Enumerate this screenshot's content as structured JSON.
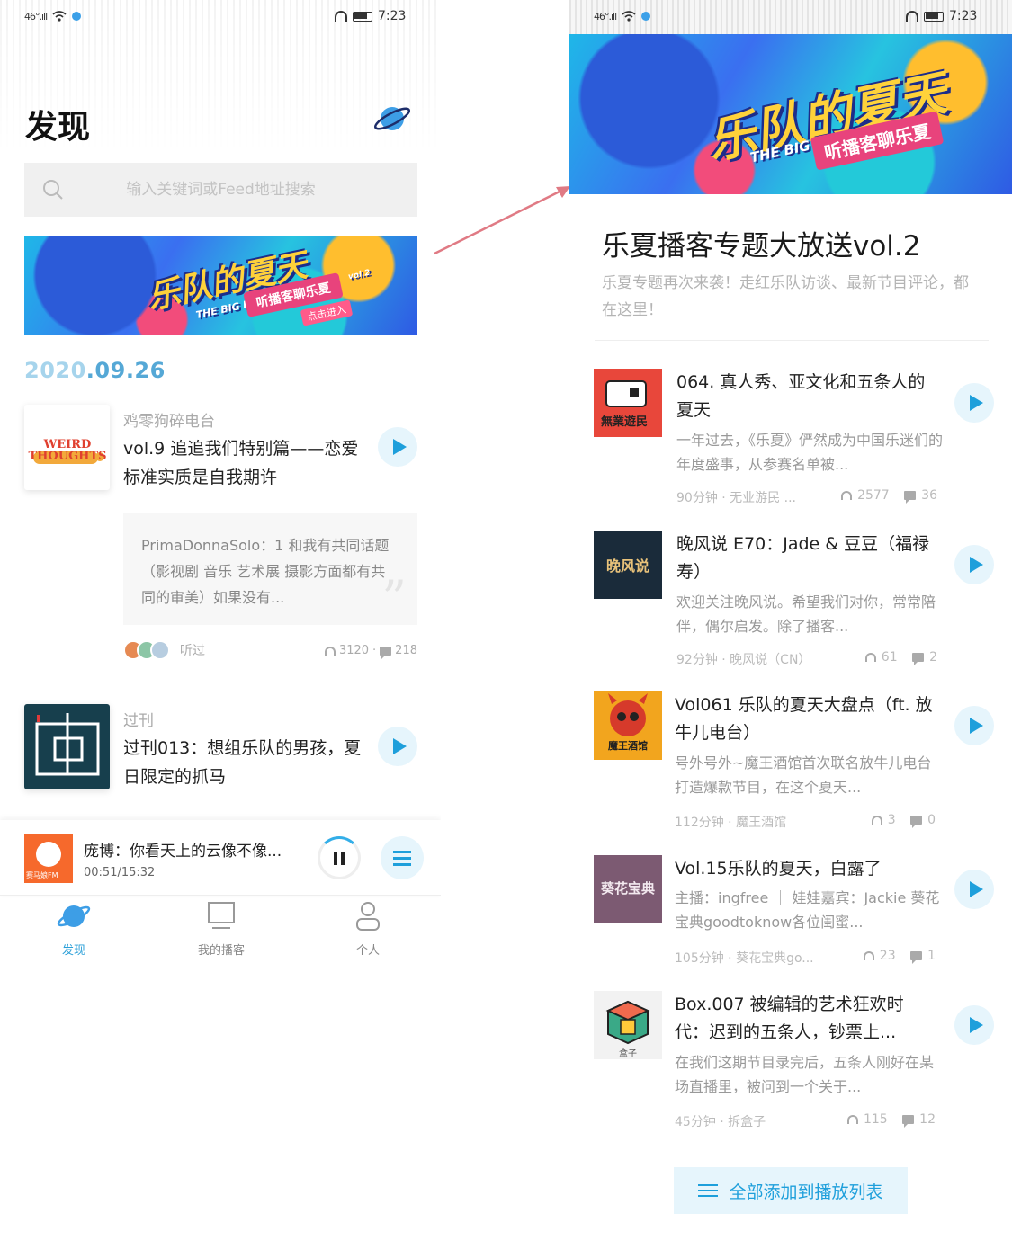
{
  "status_bar": {
    "signal": "46°.ıll",
    "time": "7:23"
  },
  "discover": {
    "title": "发现",
    "search_placeholder": "输入关键词或Feed地址搜索",
    "banner": {
      "logo": "乐队的夏天",
      "band": "THE BIG BAND",
      "ribbon": "听播客聊乐夏",
      "vol": "vol.2",
      "cta": "点击进入"
    },
    "date_prefix": "2020",
    "date_suffix": ".09.26",
    "feed": [
      {
        "source": "鸡零狗碎电台",
        "title": "vol.9 追追我们特别篇——恋爱标准实质是自我期许",
        "cover_text": "WEIRD THOUGHTS"
      },
      {
        "source": "过刊",
        "title": "过刊013：想组乐队的男孩，夏日限定的抓马"
      }
    ],
    "comment": "PrimaDonnaSolo：1 和我有共同话题（影视剧 音乐 艺术展 摄影方面都有共同的审美）如果没有...",
    "heard_label": "听过",
    "listens": "3120",
    "comments": "218",
    "now_playing": {
      "title": "庞博：你看天上的云像不像...",
      "time": "00:51/15:32",
      "thumb_label": "赛马娘FM"
    },
    "tabs": [
      {
        "label": "发现"
      },
      {
        "label": "我的播客"
      },
      {
        "label": "个人"
      }
    ]
  },
  "topic": {
    "heading": "乐夏播客专题大放送vol.2",
    "description": "乐夏专题再次来袭！走红乐队访谈、最新节目评论，都在这里！",
    "banner": {
      "logo": "乐队的夏天",
      "band": "THE BIG BAND",
      "ribbon": "听播客聊乐夏"
    },
    "episodes": [
      {
        "title": "064. 真人秀、亚文化和五条人的夏天",
        "desc": "一年过去，《乐夏》俨然成为中国乐迷们的年度盛事，从参赛名单被...",
        "meta": "90分钟 · 无业游民 ...",
        "listens": "2577",
        "comments": "36",
        "cover_label": "無業遊民"
      },
      {
        "title": "晚风说 E70：Jade & 豆豆（福禄寿）",
        "desc": "欢迎关注晚风说。希望我们对你，常常陪伴，偶尔启发。除了播客...",
        "meta": "92分钟 · 晚风说（CN）",
        "listens": "61",
        "comments": "2",
        "cover_label": "晚风说"
      },
      {
        "title": "Vol061 乐队的夏天大盘点（ft. 放牛儿电台）",
        "desc": "号外号外~魔王酒馆首次联名放牛儿电台打造爆款节目，在这个夏天...",
        "meta": "112分钟 · 魔王酒馆",
        "listens": "3",
        "comments": "0",
        "cover_label": "魔王酒馆"
      },
      {
        "title": "Vol.15乐队的夏天，白露了",
        "desc": "主播：ingfree ｜ 娃娃嘉宾：Jackie 葵花宝典goodtoknow各位闺蜜...",
        "meta": "105分钟 · 葵花宝典go...",
        "listens": "23",
        "comments": "1",
        "cover_label": "葵花宝典"
      },
      {
        "title": "Box.007 被编辑的艺术狂欢时代：迟到的五条人，钞票上...",
        "desc": "在我们这期节目录完后，五条人刚好在某场直播里，被问到一个关于...",
        "meta": "45分钟 · 拆盒子",
        "listens": "115",
        "comments": "12",
        "cover_label": "盒子"
      }
    ],
    "add_all_label": "全部添加到播放列表"
  },
  "colors": {
    "accent": "#1e9fdb",
    "date": "#55a8d6",
    "arrow": "#e07a84"
  }
}
